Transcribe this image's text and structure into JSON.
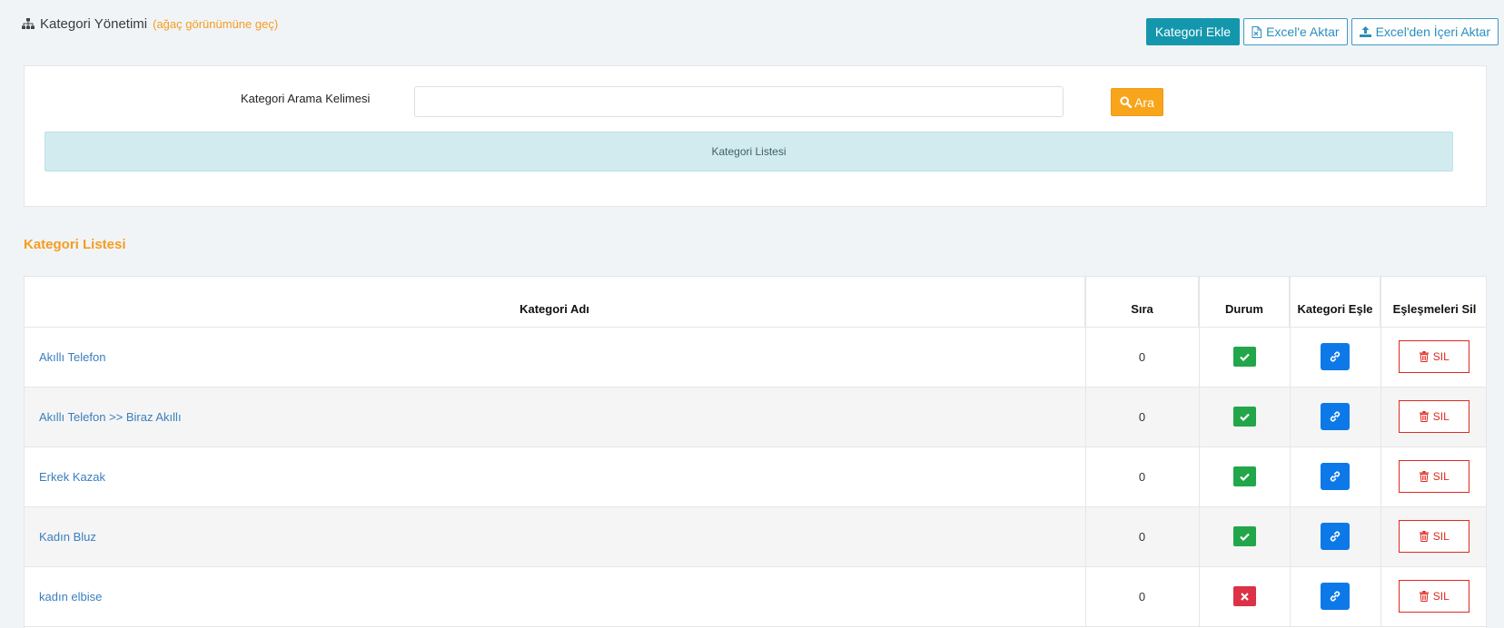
{
  "header": {
    "title": "Kategori Yönetimi",
    "tree_link": "(ağaç görünümüne geç)"
  },
  "actions": {
    "add_label": "Kategori Ekle",
    "export_label": "Excel'e Aktar",
    "import_label": "Excel'den İçeri Aktar"
  },
  "search": {
    "label": "Kategori Arama Kelimesi",
    "value": "",
    "button_label": "Ara",
    "banner": "Kategori Listesi"
  },
  "list": {
    "title": "Kategori Listesi",
    "columns": {
      "name": "Kategori Adı",
      "order": "Sıra",
      "status": "Durum",
      "match": "Kategori Eşle",
      "unmatch": "Eşleşmeleri Sil"
    },
    "delete_label": "SIL",
    "rows": [
      {
        "name": "Akıllı Telefon",
        "order": "0",
        "active": true
      },
      {
        "name": "Akıllı Telefon >> Biraz Akıllı",
        "order": "0",
        "active": true
      },
      {
        "name": "Erkek Kazak",
        "order": "0",
        "active": true
      },
      {
        "name": "Kadın Bluz",
        "order": "0",
        "active": true
      },
      {
        "name": "kadın elbise",
        "order": "0",
        "active": false
      }
    ]
  },
  "colors": {
    "accent": "#f59d1e",
    "teal": "#1497ac",
    "active": "#22a64a",
    "inactive": "#dc3146",
    "link": "#0d79e8",
    "danger": "#e0281f"
  },
  "icons": {
    "header": "sitemap-icon",
    "export": "file-excel-icon",
    "import": "upload-icon",
    "search": "search-icon",
    "match": "link-icon",
    "delete": "trash-icon",
    "active": "check-icon",
    "inactive": "times-icon"
  }
}
